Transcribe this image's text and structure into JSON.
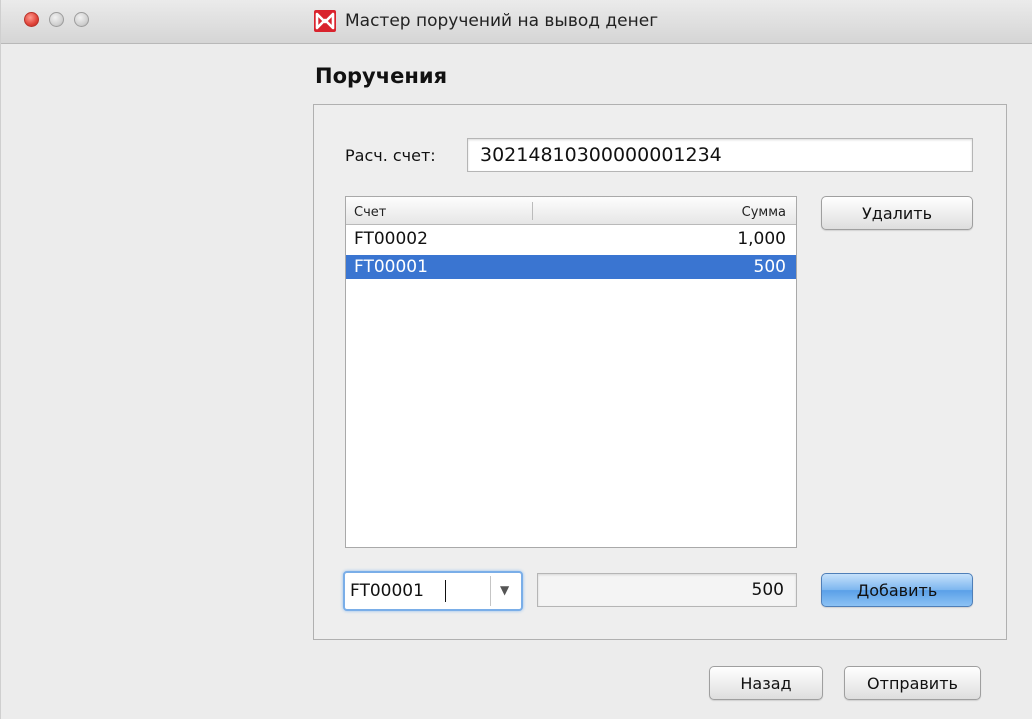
{
  "window": {
    "title": "Мастер поручений на вывод денег",
    "logo_icon": "moex-logo-icon",
    "logo_color": "#d9232d"
  },
  "page": {
    "title": "Поручения"
  },
  "account": {
    "label": "Расч. счет:",
    "value": "30214810300000001234"
  },
  "table": {
    "columns": [
      "Счет",
      "Сумма"
    ],
    "rows": [
      {
        "account": "FT00002",
        "amount": "1,000",
        "selected": false
      },
      {
        "account": "FT00001",
        "amount": "500",
        "selected": true
      }
    ],
    "selection_color": "#3a75d1"
  },
  "buttons": {
    "delete": "Удалить",
    "add": "Добавить",
    "back": "Назад",
    "send": "Отправить"
  },
  "entry": {
    "account_value": "FT00001",
    "amount_value": "500"
  }
}
